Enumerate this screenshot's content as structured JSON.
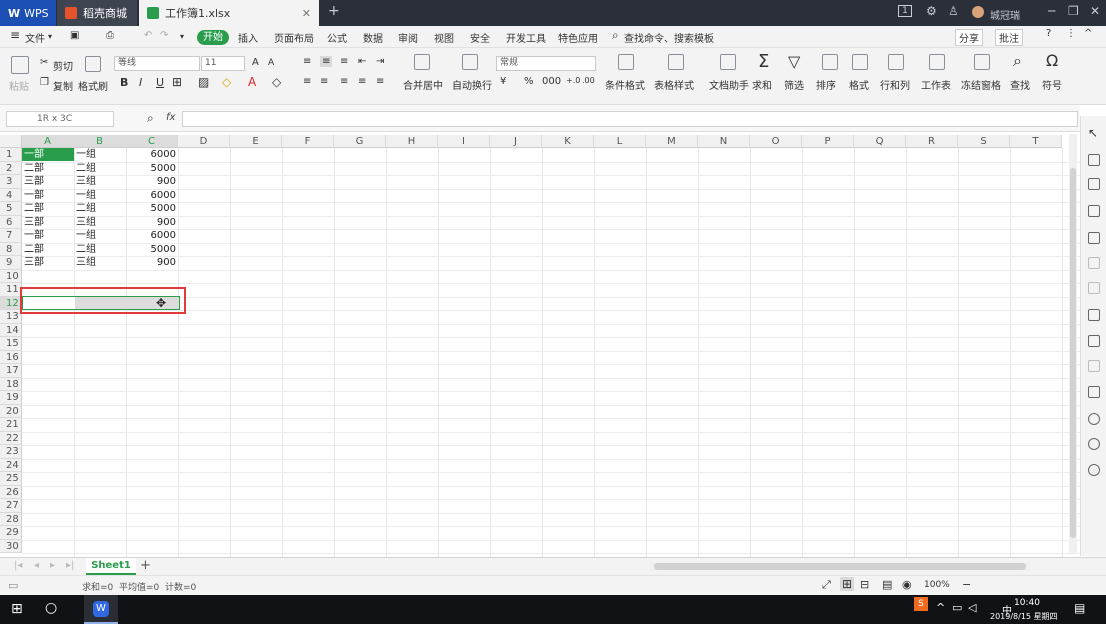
{
  "titlebar": {
    "tabs": [
      {
        "label": "WPS"
      },
      {
        "label": "稻壳商城"
      },
      {
        "label": "工作簿1.xlsx"
      }
    ],
    "page_badge": "1",
    "user": "城冠瑞"
  },
  "menubar": {
    "file": "文件",
    "start": "开始",
    "items": [
      "插入",
      "页面布局",
      "公式",
      "数据",
      "审阅",
      "视图",
      "安全",
      "开发工具",
      "特色应用"
    ],
    "search": "查找命令、搜索模板",
    "share": "分享",
    "comment": "批注"
  },
  "ribbon": {
    "paste": "粘贴",
    "cut": "剪切",
    "copy": "复制",
    "format_painter": "格式刷",
    "font_name": "等线",
    "font_size": "11",
    "bold": "B",
    "italic": "I",
    "underline": "U",
    "merge_center": "合并居中",
    "wrap_text": "自动换行",
    "number_format": "常规",
    "conditional_format": "条件格式",
    "table_style": "表格样式",
    "doc_helper": "文档助手",
    "sum": "求和",
    "filter": "筛选",
    "sort": "排序",
    "format": "格式",
    "row_col": "行和列",
    "worksheet": "工作表",
    "freeze": "冻结窗格",
    "find": "查找",
    "symbol": "符号"
  },
  "formula_bar": {
    "name_box": "1R x 3C",
    "fx": "fx",
    "value": ""
  },
  "grid": {
    "columns": [
      "A",
      "B",
      "C",
      "D",
      "E",
      "F",
      "G",
      "H",
      "I",
      "J",
      "K",
      "L",
      "M",
      "N",
      "O",
      "P",
      "Q",
      "R",
      "S",
      "T"
    ],
    "rows": [
      "1",
      "2",
      "3",
      "4",
      "5",
      "6",
      "7",
      "8",
      "9",
      "10",
      "11",
      "12",
      "13",
      "14",
      "15",
      "16",
      "17",
      "18",
      "19",
      "20",
      "21",
      "22",
      "23",
      "24",
      "25",
      "26",
      "27",
      "28",
      "29",
      "30"
    ],
    "data": [
      [
        "一部",
        "一组",
        "6000"
      ],
      [
        "二部",
        "二组",
        "5000"
      ],
      [
        "三部",
        "三组",
        "900"
      ],
      [
        "一部",
        "一组",
        "6000"
      ],
      [
        "二部",
        "二组",
        "5000"
      ],
      [
        "三部",
        "三组",
        "900"
      ],
      [
        "一部",
        "一组",
        "6000"
      ],
      [
        "二部",
        "二组",
        "5000"
      ],
      [
        "三部",
        "三组",
        "900"
      ]
    ]
  },
  "sheetbar": {
    "sheet": "Sheet1",
    "add": "+"
  },
  "statusbar": {
    "summary": "求和=0  平均值=0  计数=0",
    "zoom": "100%"
  },
  "taskbar": {
    "time": "10:40",
    "date": "2019/8/15 星期四",
    "ime": "中"
  },
  "colors": {
    "accent": "#2a9d4c",
    "highlight_box": "#e03a3a"
  }
}
